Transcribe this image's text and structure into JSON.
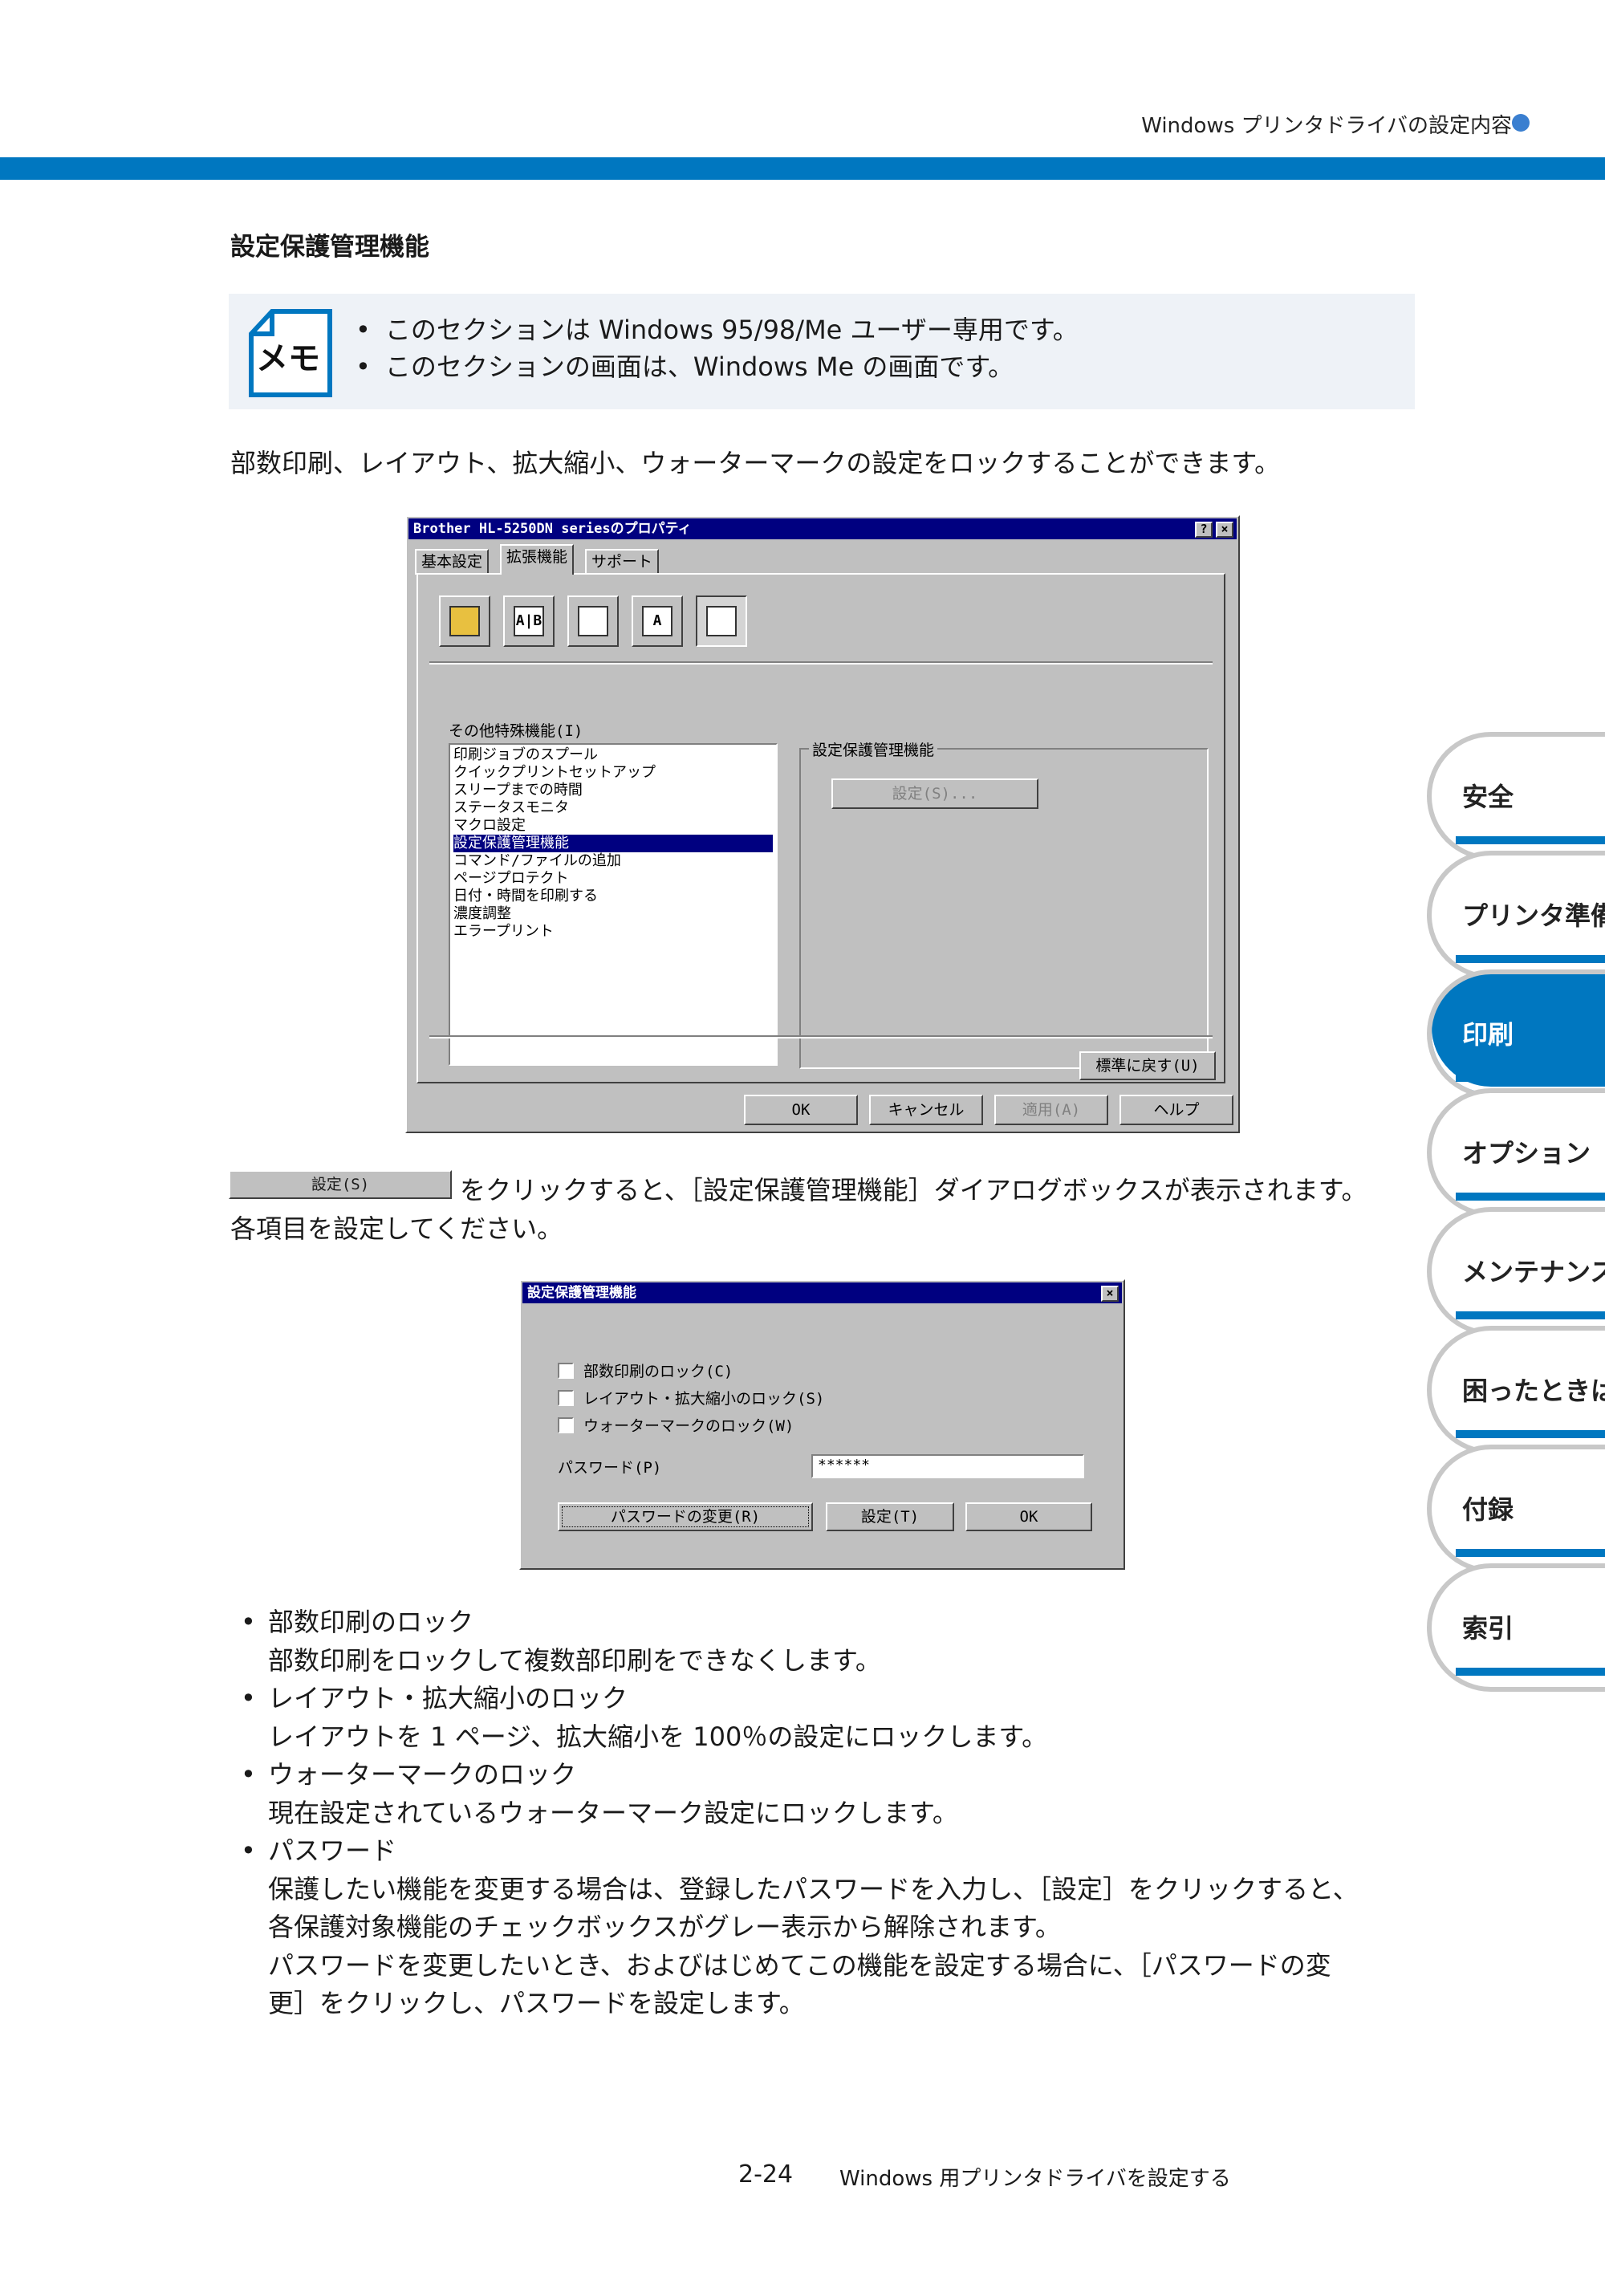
{
  "header": {
    "title": "Windows プリンタドライバの設定内容"
  },
  "section_title": "設定保護管理機能",
  "memo": {
    "icon_label": "メモ",
    "items": [
      "このセクションは Windows 95/98/Me ユーザー専用です。",
      "このセクションの画面は、Windows Me の画面です。"
    ]
  },
  "intro": "部数印刷、レイアウト、拡大縮小、ウォーターマークの設定をロックすることができます。",
  "dialog1": {
    "title": "Brother HL-5250DN seriesのプロパティ",
    "help_btn": "?",
    "close_btn": "×",
    "tabs": [
      "基本設定",
      "拡張機能",
      "サポート"
    ],
    "tool_icons": [
      "watermark-icon",
      "ab-icon",
      "page-icon",
      "font-icon",
      "settings-icon"
    ],
    "tool_glyphs": [
      "",
      "A|B",
      "",
      "A",
      ""
    ],
    "list_label": "その他特殊機能(I)",
    "list_items": [
      "印刷ジョブのスプール",
      "クイックプリントセットアップ",
      "スリープまでの時間",
      "ステータスモニタ",
      "マクロ設定",
      "設定保護管理機能",
      "コマンド/ファイルの追加",
      "ページプロテクト",
      "日付・時間を印刷する",
      "濃度調整",
      "エラープリント"
    ],
    "selected_index": 5,
    "group_label": "設定保護管理機能",
    "group_button": "設定(S)...",
    "defaults_btn": "標準に戻す(U)",
    "ok": "OK",
    "cancel": "キャンセル",
    "apply": "適用(A)",
    "help": "ヘルプ"
  },
  "inline_button": "設定(S)",
  "after_button": "をクリックすると、［設定保護管理機能］ダイアログボックスが表示されます。",
  "after_button2": "各項目を設定してください。",
  "dialog2": {
    "title": "設定保護管理機能",
    "close_btn": "×",
    "checks": [
      "部数印刷のロック(C)",
      "レイアウト・拡大縮小のロック(S)",
      "ウォーターマークのロック(W)"
    ],
    "password_label": "パスワード(P)",
    "password_value": "******",
    "change_btn": "パスワードの変更(R)",
    "set_btn": "設定(T)",
    "ok_btn": "OK"
  },
  "bullets": [
    {
      "head": "部数印刷のロック",
      "body": [
        "部数印刷をロックして複数部印刷をできなくします。"
      ]
    },
    {
      "head": "レイアウト・拡大縮小のロック",
      "body": [
        "レイアウトを 1 ページ、拡大縮小を 100％の設定にロックします。"
      ]
    },
    {
      "head": "ウォーターマークのロック",
      "body": [
        "現在設定されているウォーターマーク設定にロックします。"
      ]
    },
    {
      "head": "パスワード",
      "body": [
        "保護したい機能を変更する場合は、登録したパスワードを入力し、［設定］をクリックすると、",
        "各保護対象機能のチェックボックスがグレー表示から解除されます。",
        "パスワードを変更したいとき、およびはじめてこの機能を設定する場合に、［パスワードの変",
        "更］をクリックし、パスワードを設定します。"
      ]
    }
  ],
  "footer": {
    "page": "2-24",
    "title": "Windows 用プリンタドライバを設定する"
  },
  "side_tabs": [
    "安全",
    "プリンタ準備",
    "印刷",
    "オプション",
    "メンテナンス",
    "困ったときは",
    "付録",
    "索引"
  ],
  "active_side_tab": 2,
  "colors": {
    "accent": "#0077c0",
    "memo_bg": "#eef2f7",
    "title_blue": "#000080"
  }
}
